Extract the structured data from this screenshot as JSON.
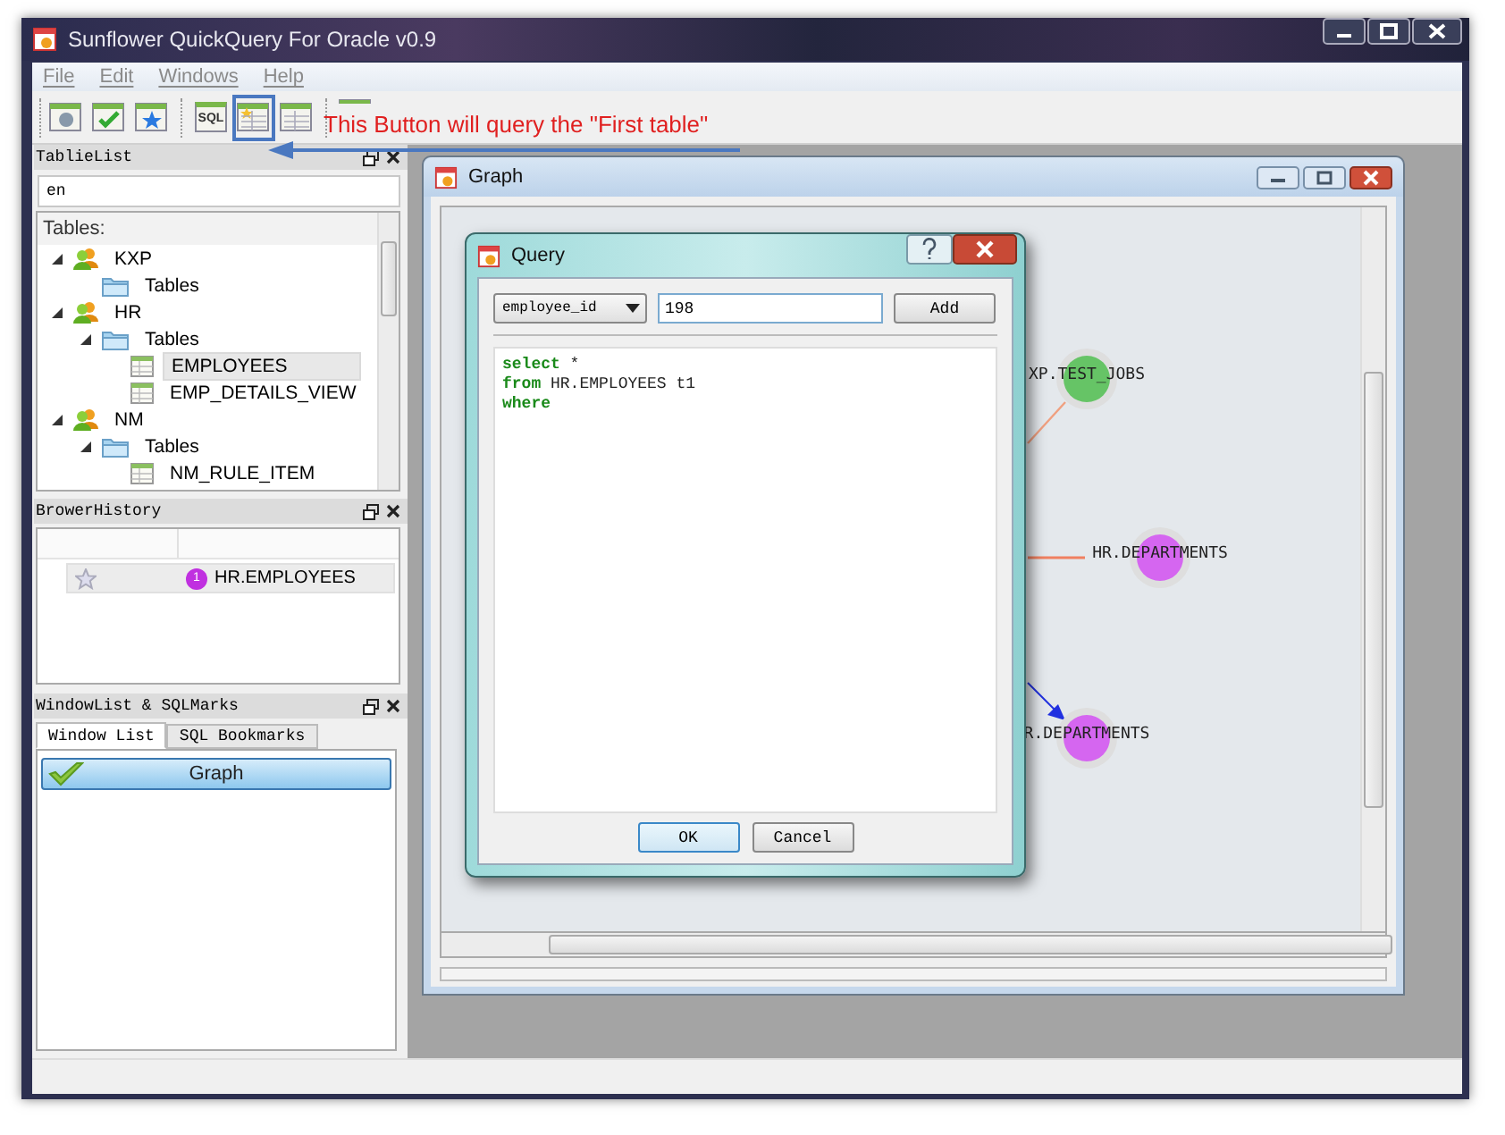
{
  "window": {
    "title": "Sunflower QuickQuery For Oracle v0.9"
  },
  "menu": [
    {
      "label": "File"
    },
    {
      "label": "Edit"
    },
    {
      "label": "Windows"
    },
    {
      "label": "Help"
    }
  ],
  "toolbar": [
    {
      "highlighted": false
    },
    {
      "highlighted": false
    },
    {
      "highlighted": false
    },
    {
      "label": "SQL",
      "highlighted": false
    },
    {
      "highlighted": true
    },
    {
      "highlighted": false
    },
    {
      "highlighted": false
    }
  ],
  "annotation": {
    "text": "This Button will query the \"First table\""
  },
  "table_list": {
    "title": "TablieList",
    "search": {
      "value": "en"
    },
    "heading": "Tables:",
    "tree": [
      {
        "kind": "schema",
        "label": "KXP",
        "children": [
          {
            "kind": "folder",
            "label": "Tables"
          }
        ]
      },
      {
        "kind": "schema",
        "label": "HR",
        "children": [
          {
            "kind": "folder",
            "label": "Tables",
            "children": [
              {
                "kind": "table",
                "label": "EMPLOYEES",
                "selected": true
              },
              {
                "kind": "table",
                "label": "EMP_DETAILS_VIEW",
                "selected": false
              }
            ]
          }
        ]
      },
      {
        "kind": "schema",
        "label": "NM",
        "children": [
          {
            "kind": "folder",
            "label": "Tables",
            "children": [
              {
                "kind": "table",
                "label": "NM_RULE_ITEM",
                "selected": false
              }
            ]
          }
        ]
      }
    ]
  },
  "brower_history": {
    "title": "BrowerHistory",
    "rows": [
      {
        "badge": "1",
        "name": "HR.EMPLOYEES"
      }
    ]
  },
  "window_list": {
    "title": "WindowList & SQLMarks",
    "tabs": [
      {
        "label": "Window List",
        "selected": true
      },
      {
        "label": "SQL Bookmarks",
        "selected": false
      }
    ],
    "items": [
      {
        "label": "Graph"
      }
    ]
  },
  "graph_window": {
    "title": "Graph",
    "nodes": [
      {
        "label": "XP.TEST_JOBS",
        "color": "#66c466"
      },
      {
        "label": "HR.DEPARTMENTS",
        "color": "#d566f0"
      },
      {
        "label": "R.DEPARTMENTS",
        "color": "#d566f0"
      }
    ]
  },
  "query_dialog": {
    "title": "Query",
    "column": {
      "value": "employee_id"
    },
    "value_field": {
      "value": "198"
    },
    "add_button": "Add",
    "sql": "**select** *\n**from** HR.EMPLOYEES t1\n**where**",
    "buttons": [
      "OK",
      "Cancel"
    ]
  }
}
